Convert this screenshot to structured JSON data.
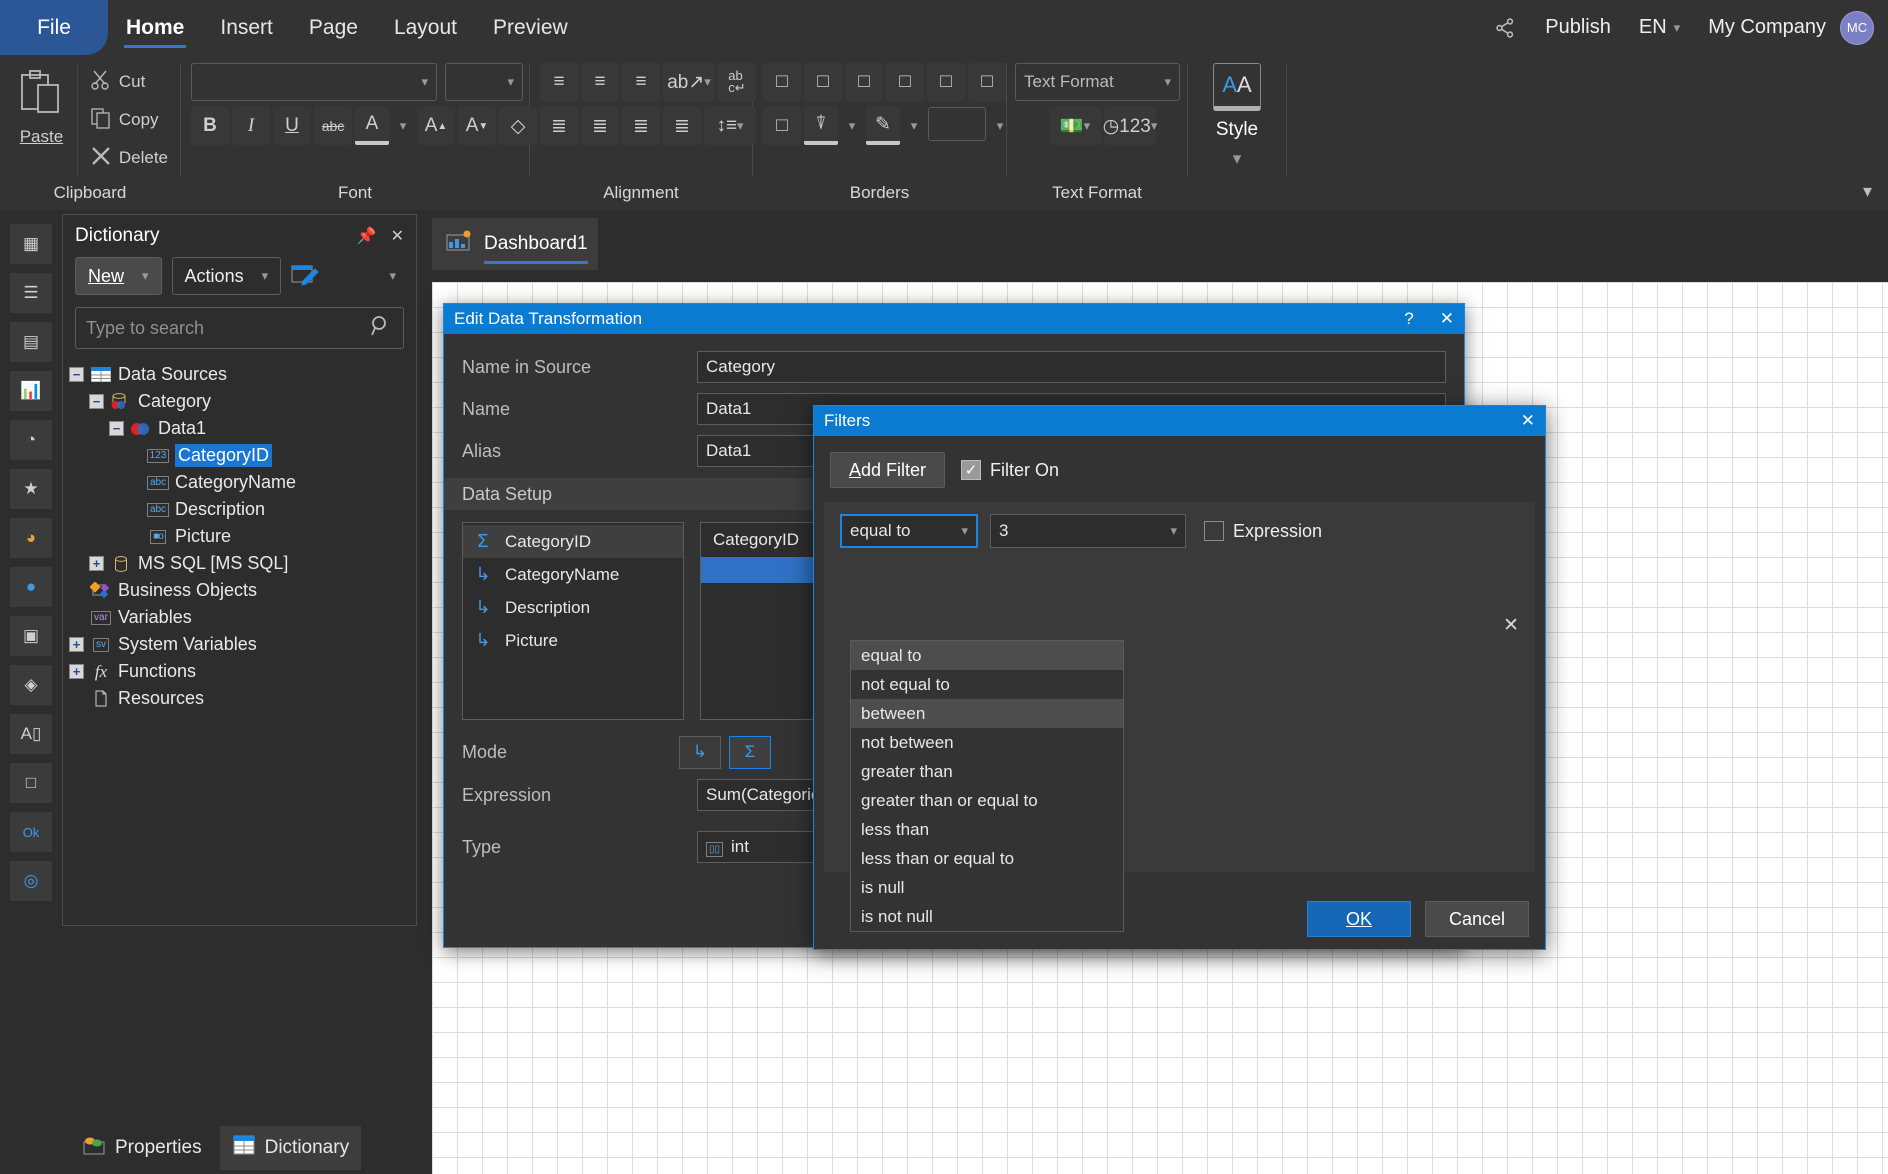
{
  "topbar": {
    "file_label": "File",
    "menu": [
      {
        "label": "Home",
        "active": true
      },
      {
        "label": "Insert",
        "active": false
      },
      {
        "label": "Page",
        "active": false
      },
      {
        "label": "Layout",
        "active": false
      },
      {
        "label": "Preview",
        "active": false
      }
    ],
    "share_icon": "share-icon",
    "publish_label": "Publish",
    "language_label": "EN",
    "company_label": "My Company",
    "avatar_initials": "MC",
    "accent_color": "#2b5797",
    "avatar_color": "#7b7fc4"
  },
  "ribbon": {
    "groups": [
      {
        "title": "Clipboard"
      },
      {
        "title": "Font"
      },
      {
        "title": "Alignment"
      },
      {
        "title": "Borders"
      },
      {
        "title": "Text Format"
      }
    ],
    "clipboard": {
      "paste_label": "Paste",
      "cut_label": "Cut",
      "copy_label": "Copy",
      "delete_label": "Delete"
    },
    "font": {
      "family_value": "",
      "size_value": "",
      "bold": "B",
      "italic": "I",
      "underline": "U",
      "strikethrough": "abc",
      "font_color": "A",
      "grow_font": "A",
      "shrink_font": "A",
      "clear_format": "clear-format-icon"
    },
    "textformat": {
      "combo_value": "Text Format"
    },
    "style": {
      "button_glyph": "AA",
      "label": "Style"
    },
    "expand_icon": "chevron-down-icon"
  },
  "rail": {
    "items": [
      {
        "name": "table-icon",
        "glyph": "▦"
      },
      {
        "name": "datagrid-icon",
        "glyph": "☰"
      },
      {
        "name": "card-icon",
        "glyph": "▤"
      },
      {
        "name": "chart-icon",
        "glyph": "█"
      },
      {
        "name": "gauge-icon",
        "glyph": "◔"
      },
      {
        "name": "indicator-icon",
        "glyph": "★"
      },
      {
        "name": "progress-icon",
        "glyph": "◕"
      },
      {
        "name": "map-icon",
        "glyph": "●"
      },
      {
        "name": "image-icon",
        "glyph": "▣"
      },
      {
        "name": "shape-icon",
        "glyph": "◈"
      },
      {
        "name": "text-icon",
        "glyph": "A"
      },
      {
        "name": "panel-icon",
        "glyph": "□"
      },
      {
        "name": "button-icon",
        "glyph": "Ok"
      },
      {
        "name": "online-icon",
        "glyph": "◎"
      }
    ]
  },
  "dictionary": {
    "title": "Dictionary",
    "pin_icon": "pin-icon",
    "close_icon": "close-icon",
    "new_label": "New",
    "actions_label": "Actions",
    "edit_icon": "edit-icon",
    "more_icon": "chevron-down-icon",
    "search_placeholder": "Type to search",
    "search_value": "",
    "search_icon": "search-icon",
    "tree": [
      {
        "label": "Data Sources",
        "depth": 0,
        "toggle": "-",
        "icon": "table-blue-icon",
        "selected": false
      },
      {
        "label": "Category",
        "depth": 1,
        "toggle": "-",
        "icon": "datasource-icon",
        "selected": false
      },
      {
        "label": "Data1",
        "depth": 2,
        "toggle": "-",
        "icon": "venn-icon",
        "selected": false
      },
      {
        "label": "CategoryID",
        "depth": 3,
        "toggle": "",
        "icon": "123-icon",
        "selected": true
      },
      {
        "label": "CategoryName",
        "depth": 3,
        "toggle": "",
        "icon": "abc-icon",
        "selected": false
      },
      {
        "label": "Description",
        "depth": 3,
        "toggle": "",
        "icon": "abc-icon",
        "selected": false
      },
      {
        "label": "Picture",
        "depth": 3,
        "toggle": "",
        "icon": "binary-icon",
        "selected": false
      },
      {
        "label": "MS SQL [MS SQL]",
        "depth": 1,
        "toggle": "+",
        "icon": "db-icon",
        "selected": false
      },
      {
        "label": "Business Objects",
        "depth": 0,
        "toggle": "",
        "icon": "objects-icon",
        "selected": false
      },
      {
        "label": "Variables",
        "depth": 0,
        "toggle": "",
        "icon": "var-icon",
        "selected": false
      },
      {
        "label": "System Variables",
        "depth": 0,
        "toggle": "+",
        "icon": "sysvar-icon",
        "selected": false
      },
      {
        "label": "Functions",
        "depth": 0,
        "toggle": "+",
        "icon": "fx-icon",
        "selected": false
      },
      {
        "label": "Resources",
        "depth": 0,
        "toggle": "",
        "icon": "resource-icon",
        "selected": false
      }
    ]
  },
  "bottom_tabs": [
    {
      "label": "Properties",
      "icon": "properties-icon",
      "active": false
    },
    {
      "label": "Dictionary",
      "icon": "dictionary-icon",
      "active": true
    }
  ],
  "workspace": {
    "doc_tab_label": "Dashboard1",
    "doc_tab_icon": "dashboard-icon"
  },
  "edit_dialog": {
    "title": "Edit Data Transformation",
    "help_icon": "?",
    "close_icon": "✕",
    "fields": [
      {
        "label": "Name in Source",
        "value": "Category"
      },
      {
        "label": "Name",
        "value": "Data1"
      },
      {
        "label": "Alias",
        "value": "Data1"
      }
    ],
    "section_label": "Data Setup",
    "columns_list": [
      {
        "label": "CategoryID",
        "icon": "sum-icon",
        "selected": true
      },
      {
        "label": "CategoryName",
        "icon": "dimension-icon",
        "selected": false
      },
      {
        "label": "Description",
        "icon": "dimension-icon",
        "selected": false
      },
      {
        "label": "Picture",
        "icon": "dimension-icon",
        "selected": false
      }
    ],
    "preview_header": "CategoryID",
    "mode_label": "Mode",
    "mode_buttons": [
      {
        "name": "dimension-mode-button",
        "glyph": "↳",
        "active": false
      },
      {
        "name": "measure-mode-button",
        "glyph": "Σ",
        "active": true
      }
    ],
    "expression_label": "Expression",
    "expression_value": "Sum(Categories.C",
    "type_label": "Type",
    "type_value": "int",
    "type_icon": "type-icon"
  },
  "filters_dialog": {
    "title": "Filters",
    "close_icon": "✕",
    "add_filter_label": "Add Filter",
    "filter_on_label": "Filter On",
    "filter_on_checked": true,
    "condition_value": "equal to",
    "value_value": "3",
    "expression_label": "Expression",
    "expression_checked": false,
    "remove_row_icon": "✕",
    "condition_options": [
      {
        "label": "equal to",
        "highlighted": true
      },
      {
        "label": "not equal to",
        "highlighted": false
      },
      {
        "label": "between",
        "highlighted": true
      },
      {
        "label": "not between",
        "highlighted": false
      },
      {
        "label": "greater than",
        "highlighted": false
      },
      {
        "label": "greater than or equal to",
        "highlighted": false
      },
      {
        "label": "less than",
        "highlighted": false
      },
      {
        "label": "less than or equal to",
        "highlighted": false
      },
      {
        "label": "is null",
        "highlighted": false
      },
      {
        "label": "is not null",
        "highlighted": false
      }
    ],
    "ok_label": "OK",
    "cancel_label": "Cancel"
  }
}
